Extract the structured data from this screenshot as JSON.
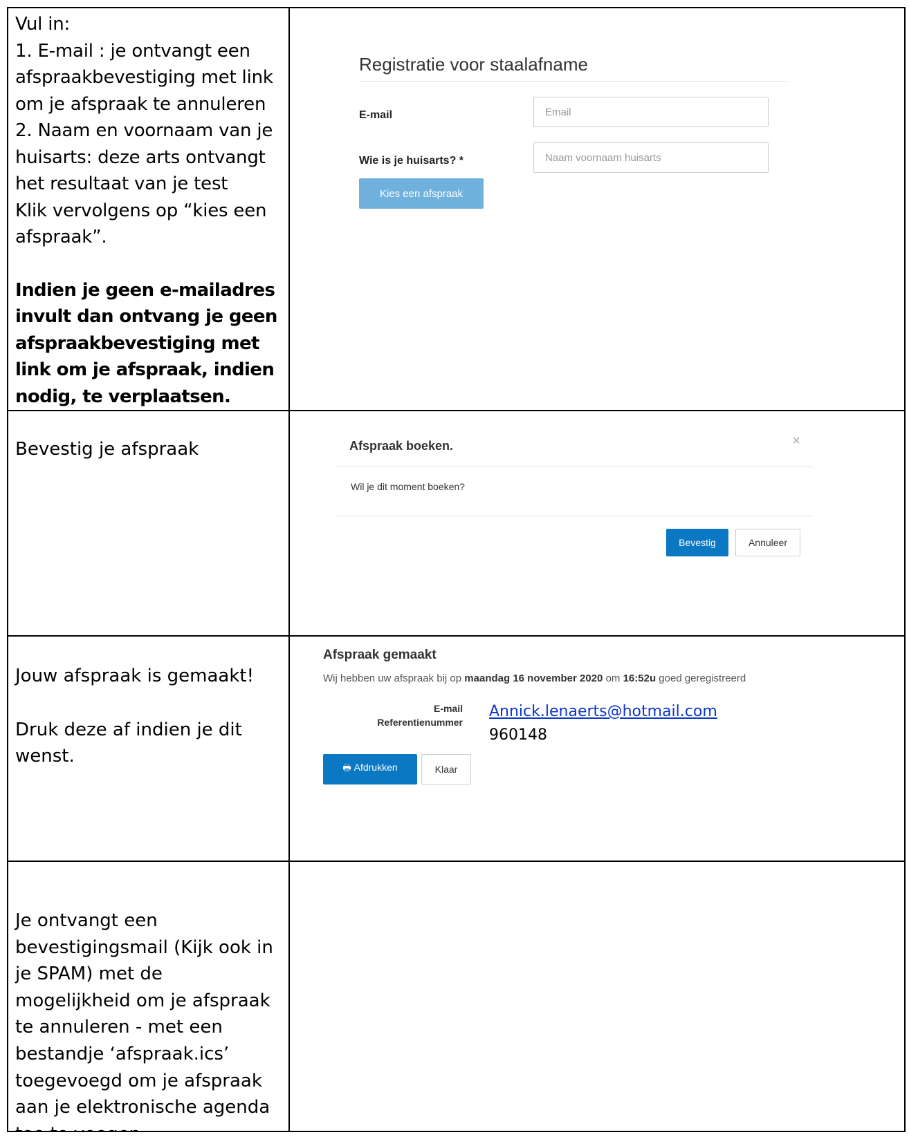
{
  "row1": {
    "instructions": [
      "Vul in:",
      "1. E-mail : je ontvangt een afspraakbevestiging met link om je afspraak te annuleren",
      "2. Naam en voornaam van je huisarts: deze arts ontvangt het resultaat van je test",
      "Klik vervolgens op “kies een afspraak”."
    ],
    "warning": "Indien je geen e-mailadres invult dan ontvang je geen afspraakbevestiging met link om je afspraak, indien nodig, te verplaatsen.",
    "form": {
      "title": "Registratie voor staalafname",
      "email_label": "E-mail",
      "email_placeholder": "Email",
      "doctor_label": "Wie is je huisarts? *",
      "doctor_placeholder": "Naam voornaam huisarts",
      "submit_label": "Kies een afspraak"
    }
  },
  "row2": {
    "text": "Bevestig je afspraak",
    "modal": {
      "title": "Afspraak boeken.",
      "close_symbol": "×",
      "question": "Wil je dit moment boeken?",
      "confirm_label": "Bevestig",
      "cancel_label": "Annuleer"
    }
  },
  "row3": {
    "text1": "Jouw afspraak is gemaakt!",
    "text2": "Druk deze af indien je dit wenst.",
    "confirmation": {
      "title": "Afspraak gemaakt",
      "line_prefix": "Wij hebben uw afspraak bij op",
      "date": "maandag 16 november 2020",
      "line_mid": "om",
      "time": "16:52u",
      "line_suffix": "goed geregistreerd",
      "email_label": "E-mail",
      "reference_label": "Referentienummer",
      "email_value": "Annick.lenaerts@hotmail.com",
      "reference_value": "960148",
      "print_label": "Afdrukken",
      "print_icon": "printer-icon",
      "done_label": "Klaar"
    }
  },
  "row4": {
    "text": "Je ontvangt een bevestigingsmail (Kijk ook in je SPAM) met de mogelijkheid om je afspraak te annuleren - met een bestandje ‘afspraak.ics’ toegevoegd om je afspraak aan je elektronische agenda toe te voegen."
  }
}
